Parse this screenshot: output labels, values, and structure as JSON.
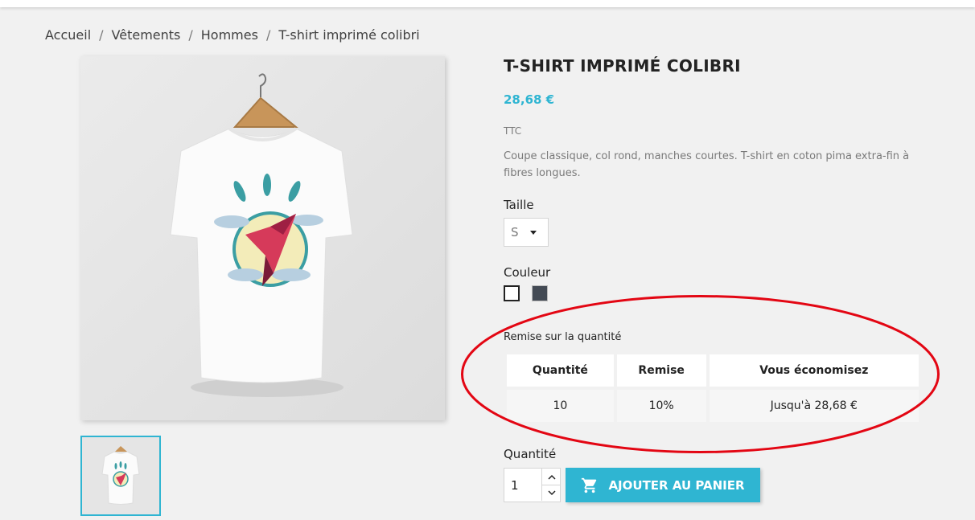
{
  "breadcrumb": {
    "items": [
      "Accueil",
      "Vêtements",
      "Hommes",
      "T-shirt imprimé colibri"
    ],
    "separator": "/"
  },
  "product": {
    "title": "T-SHIRT IMPRIMÉ COLIBRI",
    "price": "28,68 €",
    "tax_label": "TTC",
    "description": "Coupe classique, col rond, manches courtes. T-shirt en coton pima extra-fin à fibres longues."
  },
  "variants": {
    "size_label": "Taille",
    "size_value": "S",
    "color_label": "Couleur",
    "colors": [
      "#ffffff",
      "#434a54"
    ]
  },
  "discount": {
    "title": "Remise sur la quantité",
    "headers": [
      "Quantité",
      "Remise",
      "Vous économisez"
    ],
    "rows": [
      [
        "10",
        "10%",
        "Jusqu'à 28,68 €"
      ]
    ]
  },
  "quantity": {
    "label": "Quantité",
    "value": "1"
  },
  "cart": {
    "button_label": "AJOUTER AU PANIER",
    "icon": "shopping-cart-icon"
  },
  "colors": {
    "accent": "#2fb5d2",
    "annotation": "#e30613",
    "background": "#f1f1f1"
  }
}
